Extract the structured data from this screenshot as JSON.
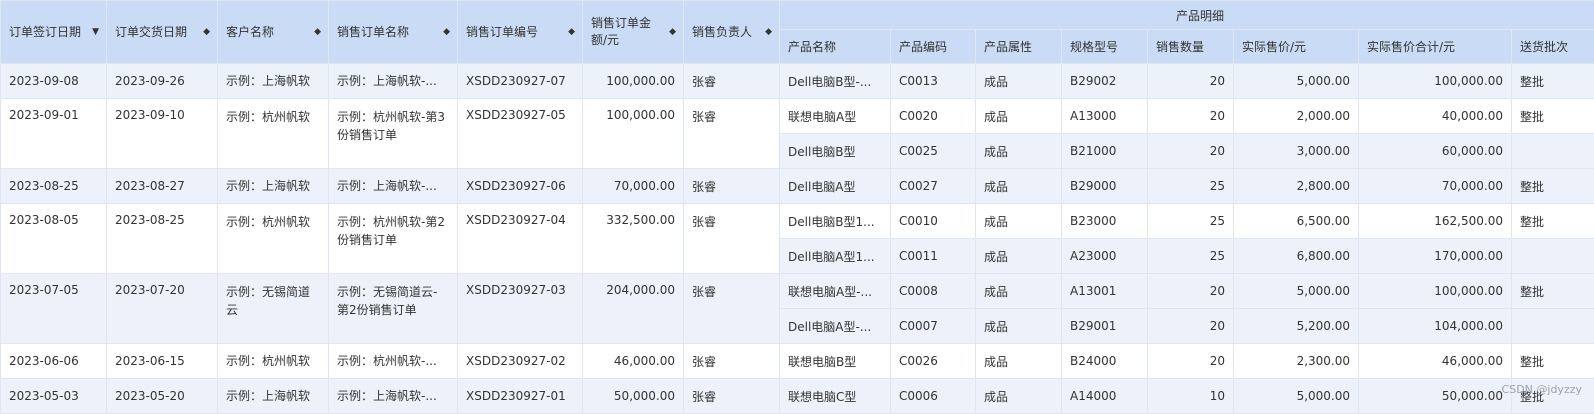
{
  "headers": {
    "sign_date": "订单签订日期",
    "delivery_date": "订单交货日期",
    "customer": "客户名称",
    "order_name": "销售订单名称",
    "order_no": "销售订单编号",
    "amount": "销售订单金额/元",
    "owner": "销售负责人",
    "details_group": "产品明细",
    "product_name": "产品名称",
    "product_code": "产品编码",
    "product_attr": "产品属性",
    "spec": "规格型号",
    "qty": "销售数量",
    "unit_price": "实际售价/元",
    "total_price": "实际售价合计/元",
    "delivery_batch": "送货批次"
  },
  "orders": [
    {
      "sign_date": "2023-09-08",
      "delivery_date": "2023-09-26",
      "customer": "示例：上海帆软",
      "order_name": "示例：上海帆软-...",
      "order_no": "XSDD230927-07",
      "amount": "100,000.00",
      "owner": "张睿",
      "items": [
        {
          "name": "Dell电脑B型-...",
          "code": "C0013",
          "attr": "成品",
          "spec": "B29002",
          "qty": "20",
          "price": "5,000.00",
          "total": "100,000.00",
          "batch": "整批"
        }
      ]
    },
    {
      "sign_date": "2023-09-01",
      "delivery_date": "2023-09-10",
      "customer": "示例：杭州帆软",
      "order_name": "示例：杭州帆软-第3份销售订单",
      "order_no": "XSDD230927-05",
      "amount": "100,000.00",
      "owner": "张睿",
      "items": [
        {
          "name": "联想电脑A型",
          "code": "C0020",
          "attr": "成品",
          "spec": "A13000",
          "qty": "20",
          "price": "2,000.00",
          "total": "40,000.00",
          "batch": "整批"
        },
        {
          "name": "Dell电脑B型",
          "code": "C0025",
          "attr": "成品",
          "spec": "B21000",
          "qty": "20",
          "price": "3,000.00",
          "total": "60,000.00",
          "batch": ""
        }
      ]
    },
    {
      "sign_date": "2023-08-25",
      "delivery_date": "2023-08-27",
      "customer": "示例：上海帆软",
      "order_name": "示例：上海帆软-...",
      "order_no": "XSDD230927-06",
      "amount": "70,000.00",
      "owner": "张睿",
      "items": [
        {
          "name": "Dell电脑A型",
          "code": "C0027",
          "attr": "成品",
          "spec": "B29000",
          "qty": "25",
          "price": "2,800.00",
          "total": "70,000.00",
          "batch": "整批"
        }
      ]
    },
    {
      "sign_date": "2023-08-05",
      "delivery_date": "2023-08-25",
      "customer": "示例：杭州帆软",
      "order_name": "示例：杭州帆软-第2份销售订单",
      "order_no": "XSDD230927-04",
      "amount": "332,500.00",
      "owner": "张睿",
      "items": [
        {
          "name": "Dell电脑B型1...",
          "code": "C0010",
          "attr": "成品",
          "spec": "B23000",
          "qty": "25",
          "price": "6,500.00",
          "total": "162,500.00",
          "batch": "整批"
        },
        {
          "name": "Dell电脑A型1...",
          "code": "C0011",
          "attr": "成品",
          "spec": "A23000",
          "qty": "25",
          "price": "6,800.00",
          "total": "170,000.00",
          "batch": ""
        }
      ]
    },
    {
      "sign_date": "2023-07-05",
      "delivery_date": "2023-07-20",
      "customer": "示例：无锡简道云",
      "order_name": "示例：无锡简道云-第2份销售订单",
      "order_no": "XSDD230927-03",
      "amount": "204,000.00",
      "owner": "张睿",
      "items": [
        {
          "name": "联想电脑A型-...",
          "code": "C0008",
          "attr": "成品",
          "spec": "A13001",
          "qty": "20",
          "price": "5,000.00",
          "total": "100,000.00",
          "batch": "整批"
        },
        {
          "name": "Dell电脑A型-...",
          "code": "C0007",
          "attr": "成品",
          "spec": "B29001",
          "qty": "20",
          "price": "5,200.00",
          "total": "104,000.00",
          "batch": ""
        }
      ]
    },
    {
      "sign_date": "2023-06-06",
      "delivery_date": "2023-06-15",
      "customer": "示例：杭州帆软",
      "order_name": "示例：杭州帆软-...",
      "order_no": "XSDD230927-02",
      "amount": "46,000.00",
      "owner": "张睿",
      "items": [
        {
          "name": "联想电脑B型",
          "code": "C0026",
          "attr": "成品",
          "spec": "B24000",
          "qty": "20",
          "price": "2,300.00",
          "total": "46,000.00",
          "batch": "整批"
        }
      ]
    },
    {
      "sign_date": "2023-05-03",
      "delivery_date": "2023-05-20",
      "customer": "示例：上海帆软",
      "order_name": "示例：上海帆软-...",
      "order_no": "XSDD230927-01",
      "amount": "50,000.00",
      "owner": "张睿",
      "items": [
        {
          "name": "联想电脑C型",
          "code": "C0006",
          "attr": "成品",
          "spec": "A14000",
          "qty": "10",
          "price": "5,000.00",
          "total": "50,000.00",
          "batch": "整批"
        }
      ]
    }
  ],
  "watermark": "CSDN @jdyzzy",
  "sort_icons": {
    "sorted_desc": "sort-desc-icon",
    "sortable": "sort-both-icon"
  }
}
